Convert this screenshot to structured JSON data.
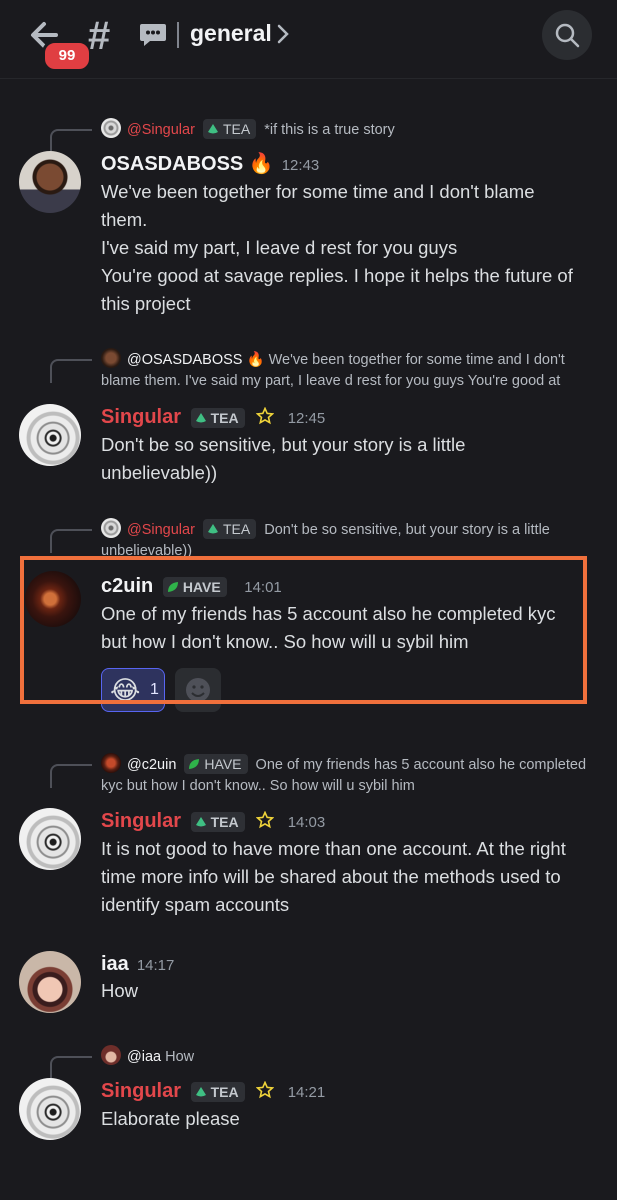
{
  "header": {
    "badge_count": "99",
    "channel_name": "general",
    "hash": "#"
  },
  "messages": [
    {
      "reply": {
        "name": "@Singular",
        "tag": "TEA",
        "text": "*if this is a true story"
      },
      "author": "OSASDABOSS",
      "emoji": "🔥",
      "time": "12:43",
      "lines": [
        "We've been together for some time and I don't blame",
        "them.",
        "I've said my part, I leave d rest for you guys",
        "You're good at savage replies. I hope it helps the future of",
        "this project"
      ]
    },
    {
      "reply": {
        "name": "@OSASDABOSS",
        "emoji": "🔥",
        "line1": "We've been together for some time and I don't",
        "line2": "blame them.  I've said my part, I leave d rest for you guys  You're good at"
      },
      "author": "Singular",
      "tag": "TEA",
      "time": "12:45",
      "lines": [
        "Don't be so sensitive, but your story is a little",
        "unbelievable))"
      ]
    },
    {
      "reply": {
        "name": "@Singular",
        "tag": "TEA",
        "line1": "Don't be so sensitive, but your story is a little",
        "line2": "unbelievable))"
      },
      "author": "c2uin",
      "tag": "HAVE",
      "time": "14:01",
      "lines": [
        "One of my friends has 5 account also he completed kyc",
        "but how I don't know.. So how will u sybil him"
      ],
      "reaction": {
        "emoji": "😂",
        "count": "1"
      }
    },
    {
      "reply": {
        "name": "@c2uin",
        "tag": "HAVE",
        "line1": "One of my friends has 5 account also he completed",
        "line2": "kyc but how I don't know.. So how will u sybil him"
      },
      "author": "Singular",
      "tag": "TEA",
      "time": "14:03",
      "lines": [
        "It is not good to have more than one account. At the right",
        "time more info will be shared about the methods used to",
        "identify spam accounts"
      ]
    },
    {
      "author": "iaa",
      "time": "14:17",
      "lines": [
        "How"
      ]
    },
    {
      "reply": {
        "name": "@iaa",
        "text": "How"
      },
      "author": "Singular",
      "tag": "TEA",
      "time": "14:21",
      "lines": [
        "Elaborate please"
      ]
    }
  ],
  "colors": {
    "accent_red": "#e2474b",
    "highlight": "#f0703c",
    "badge": "#e03e42"
  }
}
